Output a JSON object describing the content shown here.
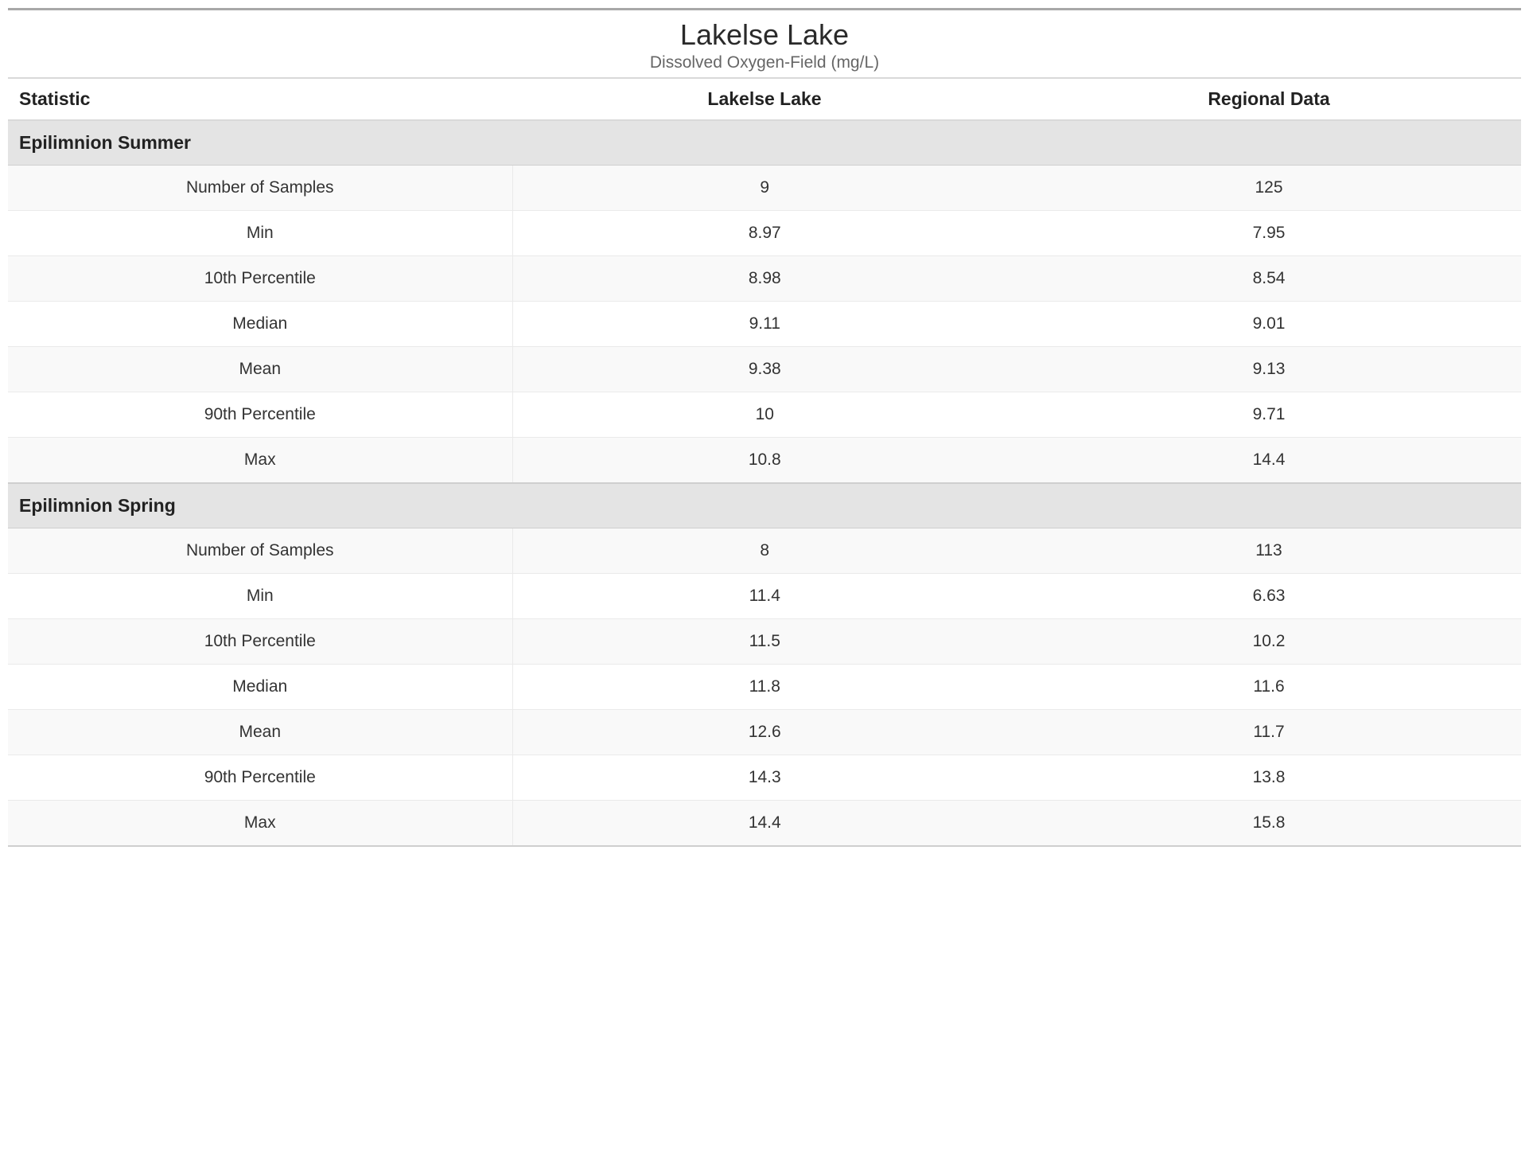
{
  "header": {
    "title": "Lakelse Lake",
    "subtitle": "Dissolved Oxygen-Field (mg/L)"
  },
  "columns": {
    "stat": "Statistic",
    "site": "Lakelse Lake",
    "regional": "Regional Data"
  },
  "chart_data": {
    "type": "table",
    "title": "Lakelse Lake — Dissolved Oxygen-Field (mg/L)",
    "columns": [
      "Statistic",
      "Lakelse Lake",
      "Regional Data"
    ],
    "sections": [
      {
        "name": "Epilimnion Summer",
        "rows": [
          {
            "stat": "Number of Samples",
            "site": "9",
            "regional": "125"
          },
          {
            "stat": "Min",
            "site": "8.97",
            "regional": "7.95"
          },
          {
            "stat": "10th Percentile",
            "site": "8.98",
            "regional": "8.54"
          },
          {
            "stat": "Median",
            "site": "9.11",
            "regional": "9.01"
          },
          {
            "stat": "Mean",
            "site": "9.38",
            "regional": "9.13"
          },
          {
            "stat": "90th Percentile",
            "site": "10",
            "regional": "9.71"
          },
          {
            "stat": "Max",
            "site": "10.8",
            "regional": "14.4"
          }
        ]
      },
      {
        "name": "Epilimnion Spring",
        "rows": [
          {
            "stat": "Number of Samples",
            "site": "8",
            "regional": "113"
          },
          {
            "stat": "Min",
            "site": "11.4",
            "regional": "6.63"
          },
          {
            "stat": "10th Percentile",
            "site": "11.5",
            "regional": "10.2"
          },
          {
            "stat": "Median",
            "site": "11.8",
            "regional": "11.6"
          },
          {
            "stat": "Mean",
            "site": "12.6",
            "regional": "11.7"
          },
          {
            "stat": "90th Percentile",
            "site": "14.3",
            "regional": "13.8"
          },
          {
            "stat": "Max",
            "site": "14.4",
            "regional": "15.8"
          }
        ]
      }
    ]
  }
}
